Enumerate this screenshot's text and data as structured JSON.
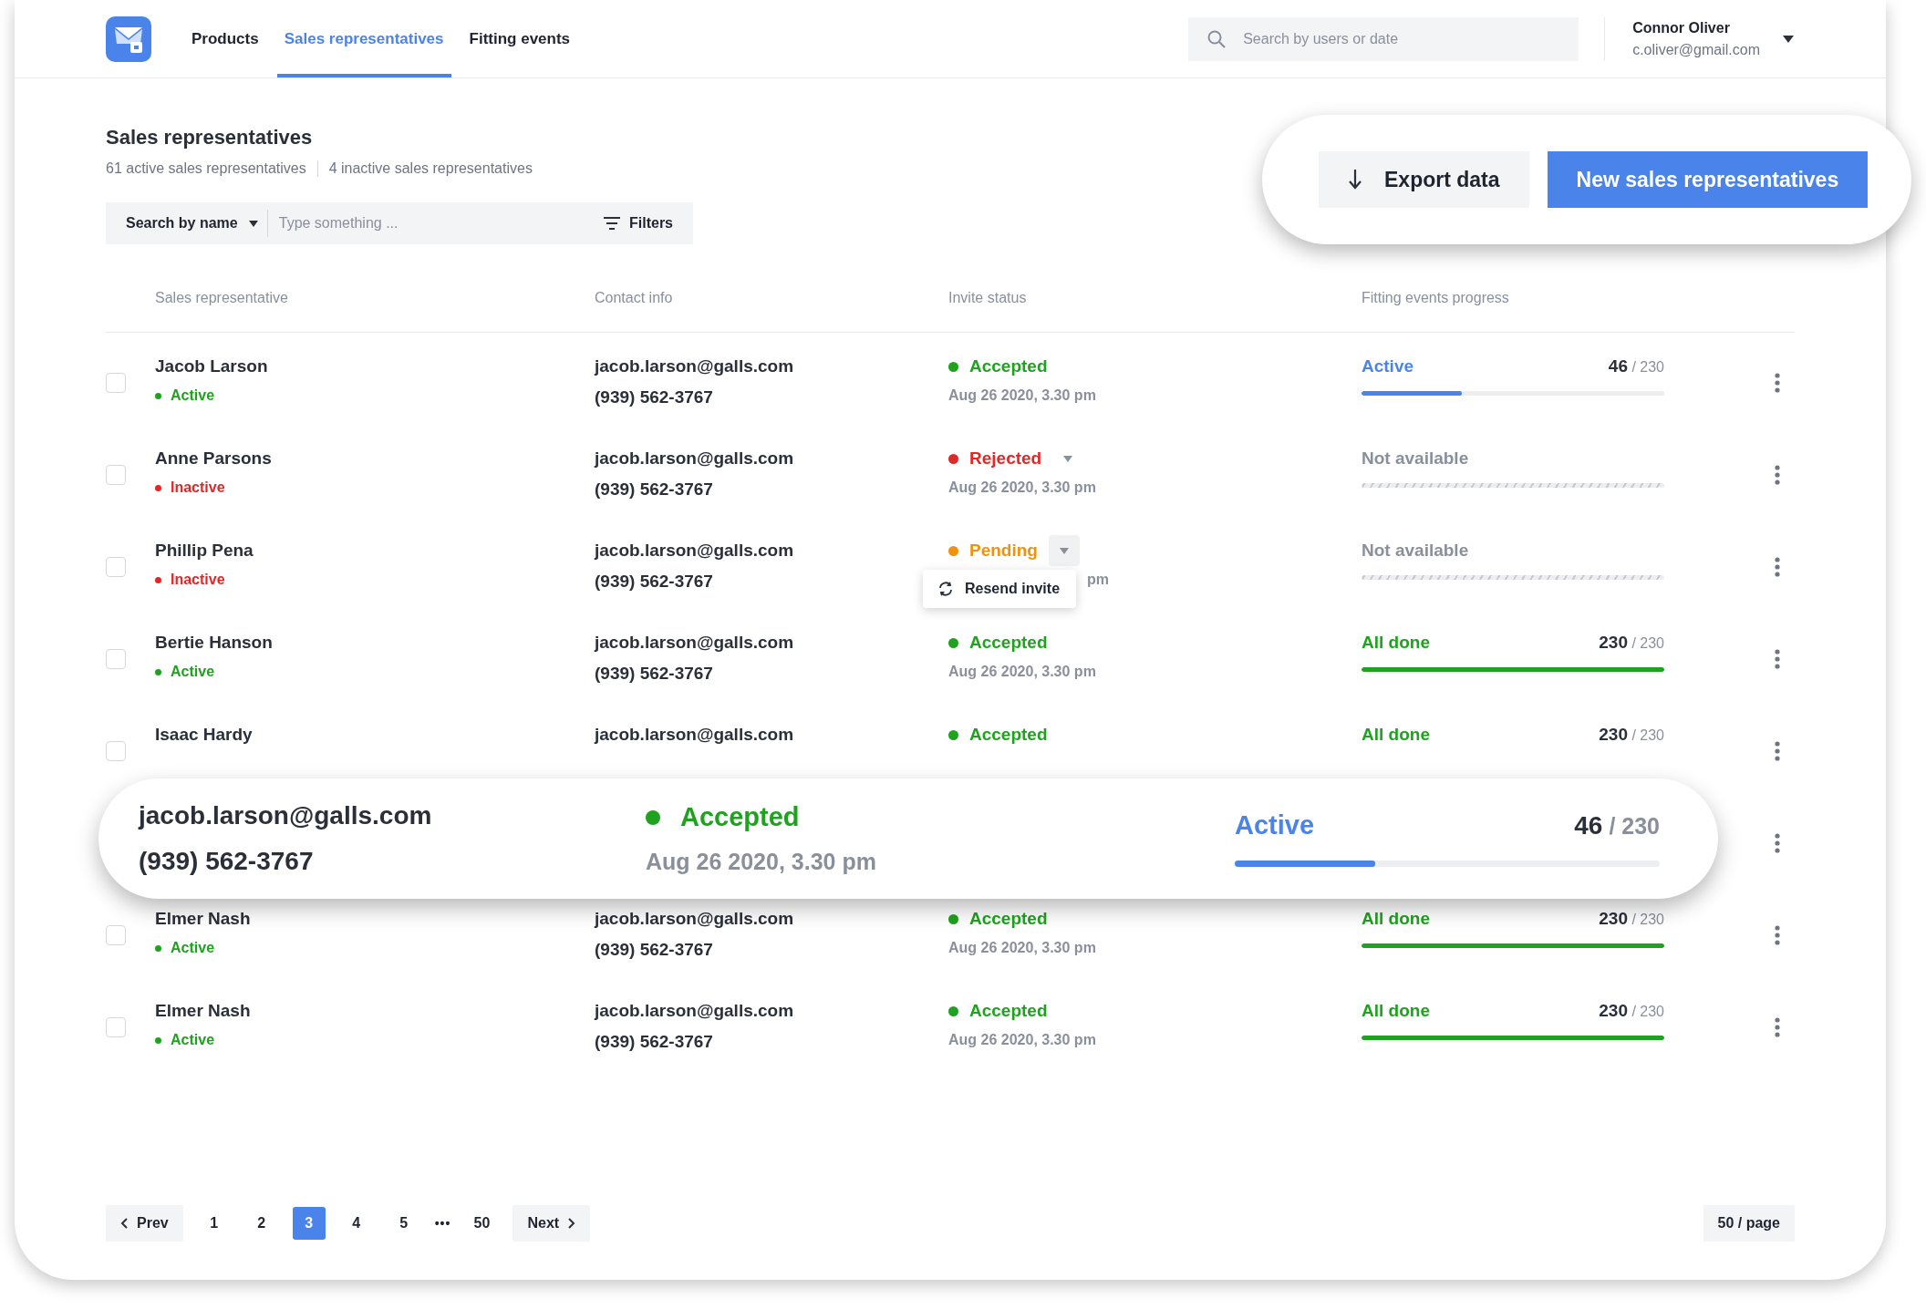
{
  "nav": {
    "tabs": [
      {
        "label": "Products",
        "selected": false
      },
      {
        "label": "Sales representatives",
        "selected": true
      },
      {
        "label": "Fitting events",
        "selected": false
      }
    ],
    "search": {
      "placeholder": "Search by users or date"
    },
    "user": {
      "name": "Connor Oliver",
      "email": "c.oliver@gmail.com"
    }
  },
  "page": {
    "title": "Sales representatives",
    "stats": [
      "61 active sales representatives",
      "4 inactive sales representatives"
    ]
  },
  "search_bar": {
    "mode": "Search by name",
    "placeholder": "Type something ...",
    "filters": "Filters"
  },
  "actions": {
    "export": "Export data",
    "create": "New sales representatives"
  },
  "table": {
    "columns": [
      "Sales representative",
      "Contact info",
      "Invite status",
      "Fitting events progress"
    ],
    "rows": [
      {
        "checked": false,
        "name": "Jacob Larson",
        "status": {
          "label": "Active",
          "kind": "active"
        },
        "email": "jacob.larson@galls.com",
        "phone": "(939) 562-3767",
        "invite": {
          "label": "Accepted",
          "kind": "accepted",
          "date": "Aug 26 2020, 3.30 pm"
        },
        "progress": {
          "kind": "active",
          "label": "Active",
          "count": "46",
          "total": "/ 230",
          "level": 0.33
        }
      },
      {
        "checked": false,
        "name": "Anne Parsons",
        "status": {
          "label": "Inactive",
          "kind": "inactive"
        },
        "email": "jacob.larson@galls.com",
        "phone": "(939) 562-3767",
        "invite": {
          "label": "Rejected",
          "kind": "rejected",
          "date": "Aug 26 2020, 3.30 pm",
          "dropdown_open": false
        },
        "progress": {
          "kind": "none",
          "label": "Not available"
        }
      },
      {
        "checked": false,
        "name": "Phillip Pena",
        "status": {
          "label": "Inactive",
          "kind": "inactive"
        },
        "email": "jacob.larson@galls.com",
        "phone": "(939) 562-3767",
        "invite": {
          "label": "Pending",
          "kind": "pending",
          "date": "pm",
          "dropdown_open": true,
          "menu": [
            "Resend invite"
          ]
        },
        "progress": {
          "kind": "none",
          "label": "Not available"
        }
      },
      {
        "checked": false,
        "name": "Bertie Hanson",
        "status": {
          "label": "Active",
          "kind": "active"
        },
        "email": "jacob.larson@galls.com",
        "phone": "(939) 562-3767",
        "invite": {
          "label": "Accepted",
          "kind": "accepted",
          "date": "Aug 26 2020, 3.30 pm"
        },
        "progress": {
          "kind": "done",
          "label": "All done",
          "count": "230",
          "total": "/ 230",
          "level": 1
        }
      },
      {
        "checked": false,
        "name": "Isaac Hardy",
        "email": "jacob.larson@galls.com",
        "invite": {
          "label": "Accepted",
          "kind": "accepted"
        },
        "progress": {
          "kind": "done",
          "label": "All done",
          "count": "230",
          "total": "/ 230"
        }
      },
      {
        "kind": "magnified",
        "lens": {
          "email": "jacob.larson@galls.com",
          "phone": "(939) 562-3767",
          "invite": {
            "label": "Accepted",
            "kind": "accepted",
            "date": "Aug 26 2020, 3.30 pm"
          },
          "progress": {
            "kind": "active",
            "label": "Active",
            "count": "46",
            "total": "/ 230",
            "level": 0.33
          }
        }
      },
      {
        "checked": false,
        "name": "Elmer Nash",
        "status": {
          "label": "Active",
          "kind": "active"
        },
        "email": "jacob.larson@galls.com",
        "phone": "(939) 562-3767",
        "invite": {
          "label": "Accepted",
          "kind": "accepted",
          "date": "Aug 26 2020, 3.30 pm"
        },
        "progress": {
          "kind": "done",
          "label": "All done",
          "count": "230",
          "total": "/ 230",
          "level": 1
        }
      },
      {
        "checked": false,
        "name": "Elmer Nash",
        "status": {
          "label": "Active",
          "kind": "active"
        },
        "email": "jacob.larson@galls.com",
        "phone": "(939) 562-3767",
        "invite": {
          "label": "Accepted",
          "kind": "accepted",
          "date": "Aug 26 2020, 3.30 pm"
        },
        "progress": {
          "kind": "done",
          "label": "All done",
          "count": "230",
          "total": "/ 230",
          "level": 1
        }
      }
    ]
  },
  "pagination": {
    "prev": "Prev",
    "next": "Next",
    "pages": [
      {
        "label": "1",
        "selected": false
      },
      {
        "label": "2",
        "selected": false
      },
      {
        "label": "3",
        "selected": true
      },
      {
        "label": "4",
        "selected": false
      },
      {
        "label": "5",
        "selected": false
      },
      {
        "label": "•••",
        "kind": "ellipsis"
      },
      {
        "label": "50",
        "selected": false
      }
    ],
    "page_size": "50 / page"
  }
}
